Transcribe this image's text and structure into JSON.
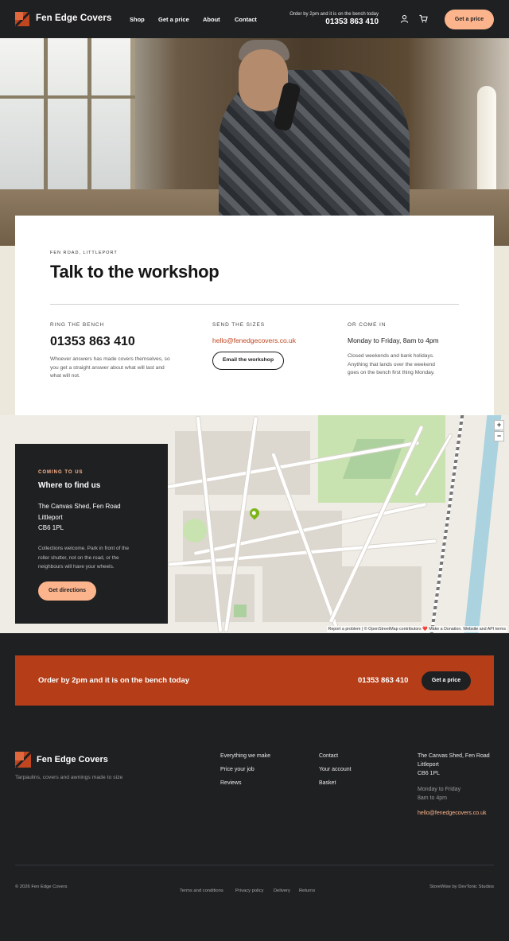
{
  "header": {
    "brand": "Fen Edge Covers",
    "nav": [
      "Shop",
      "Get a price",
      "About",
      "Contact"
    ],
    "order_note": "Order by 2pm and it is on the bench today",
    "phone": "01353 863 410",
    "cta_label": "Get a price",
    "icons": [
      "account-icon",
      "basket-icon"
    ]
  },
  "contact": {
    "eyebrow": "FEN ROAD, LITTLEPORT",
    "title": "Talk to the workshop",
    "col1": {
      "label": "RING THE BENCH",
      "phone": "01353 863 410",
      "text_lines": [
        "Whoever answers has made covers themselves, so",
        "you get a straight answer about what will last and",
        "what will not."
      ]
    },
    "col2": {
      "label": "SEND THE SIZES",
      "email": "hello@fenedgecovers.co.uk",
      "button": "Email the workshop"
    },
    "col3": {
      "label": "OR COME IN",
      "hours": "Monday to Friday, 8am to 4pm",
      "text_lines": [
        "Closed weekends and bank holidays.",
        "Anything that lands over the weekend",
        "goes on the bench first thing Monday."
      ]
    }
  },
  "map": {
    "zoom_in": "+",
    "zoom_out": "−",
    "attribution": "Report a problem | © OpenStreetMap contributors ❤️ Make a Donation. Website and API terms",
    "card": {
      "eyebrow": "COMING TO US",
      "title": "Where to find us",
      "address": [
        "The Canvas Shed, Fen Road",
        "Littleport",
        "CB6 1PL"
      ],
      "note_lines": [
        "Collections welcome. Park in front of the",
        "roller shutter, not on the road, or the",
        "neighbours will have your wheels."
      ],
      "button": "Get directions"
    }
  },
  "cta": {
    "text": "Order by 2pm and it is on the bench today",
    "phone": "01353 863 410",
    "button": "Get a price"
  },
  "footer": {
    "brand": "Fen Edge Covers",
    "tagline": "Tarpaulins, covers and awnings made to size",
    "col1": [
      "Everything we make",
      "Price your job",
      "Reviews"
    ],
    "col2": [
      "Contact",
      "Your account",
      "Basket"
    ],
    "address": [
      "The Canvas Shed, Fen Road",
      "Littleport",
      "CB6 1PL"
    ],
    "hours": [
      "Monday to Friday",
      "8am to 4pm"
    ],
    "email": "hello@fenedgecovers.co.uk",
    "copyright": "© 2026 Fen Edge Covers",
    "legal": [
      "Terms and conditions",
      "Privacy policy",
      "Delivery",
      "Returns"
    ],
    "credit": "StoreWise by DevTonic Studios"
  }
}
